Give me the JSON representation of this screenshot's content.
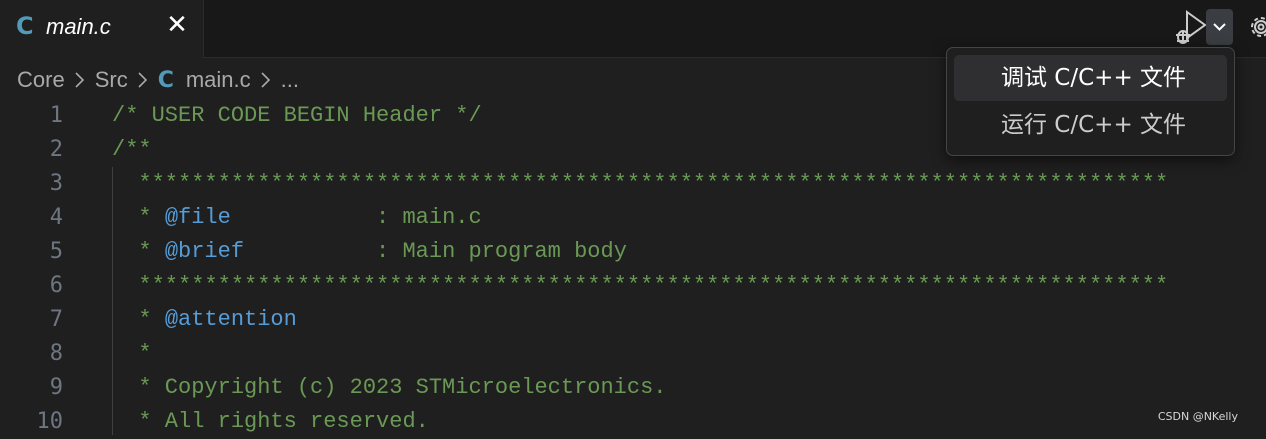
{
  "tab": {
    "language_icon": "C",
    "filename": "main.c",
    "close_glyph": "✕"
  },
  "toolbar": {
    "run_debug_icon": "run-debug-icon",
    "dropdown_icon": "chevron-down-icon",
    "settings_icon": "gear-icon"
  },
  "breadcrumb": {
    "items": [
      "Core",
      "Src"
    ],
    "file_icon": "C",
    "file": "main.c",
    "ellipsis": "..."
  },
  "editor": {
    "lines": [
      {
        "num": "1",
        "text": "/* USER CODE BEGIN Header */"
      },
      {
        "num": "2",
        "text": "/**"
      },
      {
        "num": "3",
        "text": "  ******************************************************************************"
      },
      {
        "num": "4",
        "pre": "  * ",
        "tag": "@file",
        "post": "           : main.c"
      },
      {
        "num": "5",
        "pre": "  * ",
        "tag": "@brief",
        "post": "          : Main program body"
      },
      {
        "num": "6",
        "text": "  ******************************************************************************"
      },
      {
        "num": "7",
        "pre": "  * ",
        "tag": "@attention",
        "post": ""
      },
      {
        "num": "8",
        "text": "  *"
      },
      {
        "num": "9",
        "text": "  * Copyright (c) 2023 STMicroelectronics."
      },
      {
        "num": "10",
        "text": "  * All rights reserved."
      }
    ]
  },
  "menu": {
    "items": [
      "调试 C/C++ 文件",
      "运行 C/C++ 文件"
    ]
  },
  "watermark": "CSDN @NKelly",
  "colors": {
    "comment": "#6a9955",
    "doc_tag": "#569cd6",
    "c_icon": "#519aba",
    "background": "#1f1f1f"
  }
}
